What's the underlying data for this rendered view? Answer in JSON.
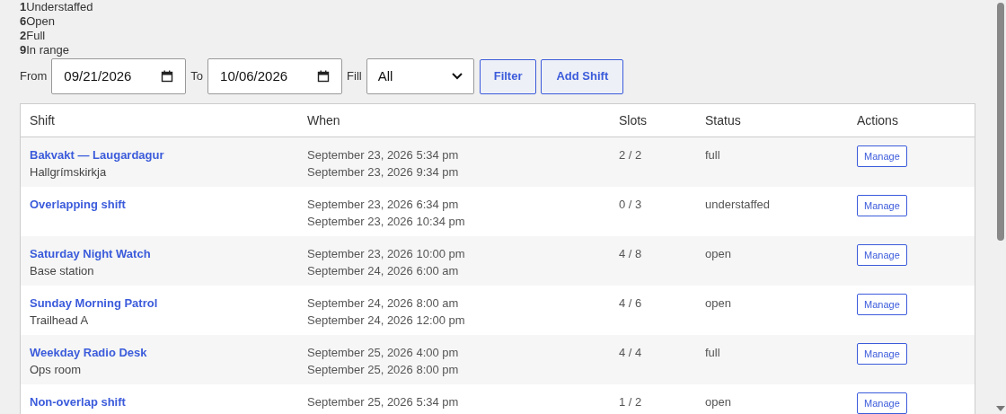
{
  "stats": [
    {
      "count": "1",
      "label": "Understaffed"
    },
    {
      "count": "6",
      "label": "Open"
    },
    {
      "count": "2",
      "label": "Full"
    },
    {
      "count": "9",
      "label": "In range"
    }
  ],
  "filters": {
    "from_label": "From",
    "from_value": "09/21/2026",
    "to_label": "To",
    "to_value": "10/06/2026",
    "fill_label": "Fill",
    "fill_value": "All",
    "filter_button": "Filter",
    "add_button": "Add Shift"
  },
  "table": {
    "columns": [
      "Shift",
      "When",
      "Slots",
      "Status",
      "Actions"
    ],
    "rows": [
      {
        "shift": "Bakvakt — Laugardagur",
        "location": "Hallgrímskirkja",
        "start": "September 23, 2026 5:34 pm",
        "end": "September 23, 2026 9:34 pm",
        "slots": "2 / 2",
        "status": "full",
        "action": "Manage"
      },
      {
        "shift": "Overlapping shift",
        "start": "September 23, 2026 6:34 pm",
        "end": "September 23, 2026 10:34 pm",
        "slots": "0 / 3",
        "status": "understaffed",
        "action": "Manage"
      },
      {
        "shift": "Saturday Night Watch",
        "location": "Base station",
        "start": "September 23, 2026 10:00 pm",
        "end": "September 24, 2026 6:00 am",
        "slots": "4 / 8",
        "status": "open",
        "action": "Manage"
      },
      {
        "shift": "Sunday Morning Patrol",
        "location": "Trailhead A",
        "start": "September 24, 2026 8:00 am",
        "end": "September 24, 2026 12:00 pm",
        "slots": "4 / 6",
        "status": "open",
        "action": "Manage"
      },
      {
        "shift": "Weekday Radio Desk",
        "location": "Ops room",
        "start": "September 25, 2026 4:00 pm",
        "end": "September 25, 2026 8:00 pm",
        "slots": "4 / 4",
        "status": "full",
        "action": "Manage"
      },
      {
        "shift": "Non-overlap shift",
        "start": "September 25, 2026 5:34 pm",
        "slots": "1 / 2",
        "status": "open",
        "action": "Manage"
      }
    ]
  }
}
